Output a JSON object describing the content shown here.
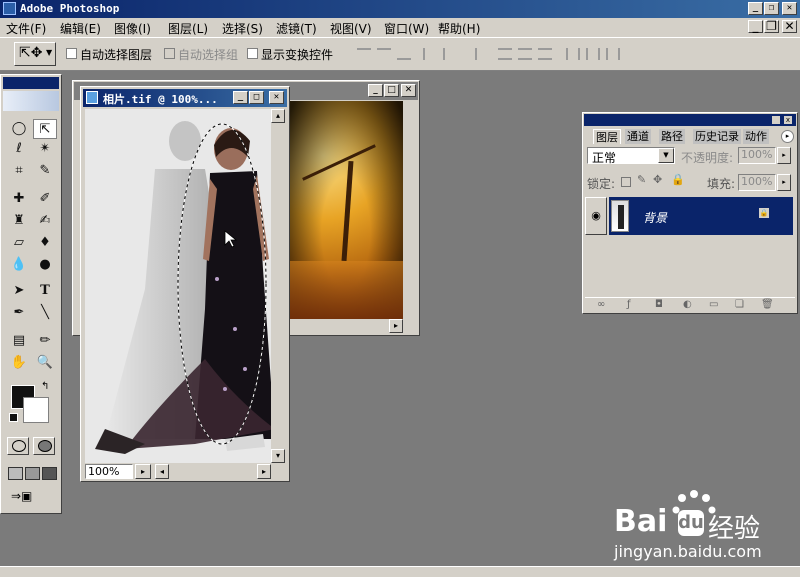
{
  "app": {
    "title": "Adobe Photoshop"
  },
  "menu": [
    "文件(F)",
    "编辑(E)",
    "图像(I)",
    "图层(L)",
    "选择(S)",
    "滤镜(T)",
    "视图(V)",
    "窗口(W)",
    "帮助(H)"
  ],
  "options": {
    "auto_select_layer": "自动选择图层",
    "auto_select_group": "自动选择组",
    "show_transform": "显示变换控件"
  },
  "front_doc": {
    "title": "相片.tif @ 100%...",
    "zoom": "100%"
  },
  "layers_panel": {
    "tabs": [
      "图层",
      "通道",
      "路径",
      "历史记录",
      "动作"
    ],
    "blend_mode": "正常",
    "opacity_label": "不透明度:",
    "opacity_value": "100%",
    "lock_label": "锁定:",
    "fill_label": "填充:",
    "fill_value": "100%",
    "layer_name": "背景"
  },
  "watermark": {
    "brand": "Bai",
    "brand2": "经验",
    "url": "jingyan.baidu.com"
  },
  "colors": {
    "titlebar": "#0a246a",
    "workspace": "#7b7b7b",
    "chrome": "#d4d0c8",
    "layer_selected": "#0a246a"
  }
}
